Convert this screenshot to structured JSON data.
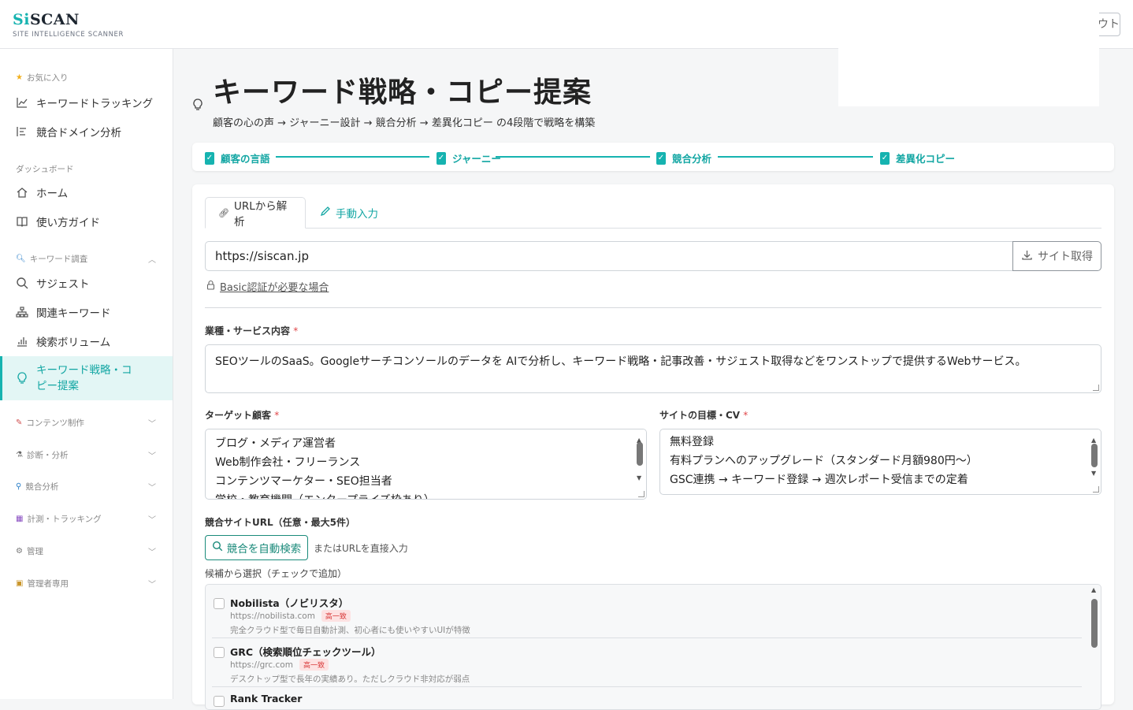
{
  "app": {
    "logo_si": "Si",
    "logo_rest": "SCAN",
    "logo_sub": "SITE INTELLIGENCE SCANNER",
    "logout_label": "ウト"
  },
  "sidebar": {
    "favorites_label": "お気に入り",
    "favorites": [
      {
        "label": "キーワードトラッキング",
        "icon": "trend-chart-icon"
      },
      {
        "label": "競合ドメイン分析",
        "icon": "list-bars-icon"
      }
    ],
    "dashboard_label": "ダッシュボード",
    "dashboard": [
      {
        "label": "ホーム",
        "icon": "home-icon"
      },
      {
        "label": "使い方ガイド",
        "icon": "book-icon"
      }
    ],
    "keyword_label": "キーワード調査",
    "keyword": [
      {
        "label": "サジェスト",
        "icon": "search-icon"
      },
      {
        "label": "関連キーワード",
        "icon": "hierarchy-icon"
      },
      {
        "label": "検索ボリューム",
        "icon": "bar-chart-icon"
      },
      {
        "label": "キーワード戦略・コピー提案",
        "icon": "bulb-icon"
      }
    ],
    "collapsed": [
      {
        "label": "コンテンツ制作",
        "icon": "memo-icon"
      },
      {
        "label": "診断・分析",
        "icon": "microscope-icon"
      },
      {
        "label": "競合分析",
        "icon": "magnifier-icon"
      },
      {
        "label": "計測・トラッキング",
        "icon": "chart-icon"
      },
      {
        "label": "管理",
        "icon": "gear-icon"
      },
      {
        "label": "管理者専用",
        "icon": "lock-icon"
      }
    ]
  },
  "page": {
    "title": "キーワード戦略・コピー提案",
    "subtitle": "顧客の心の声 → ジャーニー設計 → 競合分析 → 差異化コピー の4段階で戦略を構築"
  },
  "steps": [
    "顧客の言語",
    "ジャーニー",
    "競合分析",
    "差異化コピー"
  ],
  "tabs": {
    "url_tab": "URLから解析",
    "manual_tab": "手動入力"
  },
  "form": {
    "url_value": "https://siscan.jp",
    "fetch_label": "サイト取得",
    "basic_auth_label": "Basic認証が必要な場合",
    "industry_label": "業種・サービス内容",
    "industry_value": "SEOツールのSaaS。Googleサーチコンソールのデータを AIで分析し、キーワード戦略・記事改善・サジェスト取得などをワンストップで提供するWebサービス。",
    "target_label": "ターゲット顧客",
    "target_lines": [
      "ブログ・メディア運営者",
      "Web制作会社・フリーランス",
      "コンテンツマーケター・SEO担当者",
      "学校・教育機関（エンタープライズ枠あり）"
    ],
    "goal_label": "サイトの目標・CV",
    "goal_lines": [
      "無料登録",
      "有料プランへのアップグレード（スタンダード月額980円〜）",
      "GSC連携 → キーワード登録 → 週次レポート受信までの定着"
    ],
    "competitor_label": "競合サイトURL（任意・最大5件）",
    "auto_search_label": "競合を自動検索",
    "or_text": "またはURLを直接入力",
    "candidates_label": "候補から選択（チェックで追加）",
    "candidates": [
      {
        "name": "Nobilista（ノビリスタ）",
        "url": "https://nobilista.com",
        "badge": "高一致",
        "desc": "完全クラウド型で毎日自動計測、初心者にも使いやすいUIが特徴"
      },
      {
        "name": "GRC（検索順位チェックツール）",
        "url": "https://grc.com",
        "badge": "高一致",
        "desc": "デスクトップ型で長年の実績あり。ただしクラウド非対応が弱点"
      },
      {
        "name": "Rank Tracker",
        "url": "",
        "badge": "",
        "desc": ""
      }
    ]
  },
  "colors": {
    "accent": "#16b3b0",
    "required": "#e0464a",
    "badge_bg": "#fde2e2"
  }
}
